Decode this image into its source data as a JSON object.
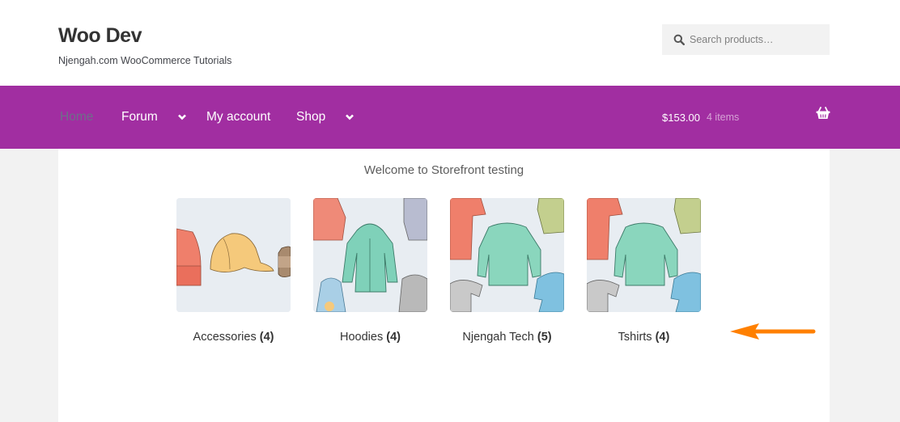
{
  "header": {
    "site_title": "Woo Dev",
    "tagline": "Njengah.com WooCommerce Tutorials",
    "search": {
      "placeholder": "Search products…",
      "value": "",
      "icon": "search-icon"
    }
  },
  "nav": {
    "items": [
      {
        "label": "Home",
        "active": true,
        "has_dropdown": false
      },
      {
        "label": "Forum",
        "active": false,
        "has_dropdown": true
      },
      {
        "label": "My account",
        "active": false,
        "has_dropdown": false
      },
      {
        "label": "Shop",
        "active": false,
        "has_dropdown": true
      }
    ],
    "cart": {
      "total": "$153.00",
      "count": "4 items",
      "icon": "basket-icon"
    }
  },
  "main": {
    "welcome": "Welcome to Storefront testing",
    "categories": [
      {
        "name": "Accessories",
        "count": "(4)",
        "image": "accessories-illustration"
      },
      {
        "name": "Hoodies",
        "count": "(4)",
        "image": "hoodies-illustration"
      },
      {
        "name": "Njengah Tech",
        "count": "(5)",
        "image": "tshirts-illustration"
      },
      {
        "name": "Tshirts",
        "count": "(4)",
        "image": "tshirts-illustration"
      }
    ]
  },
  "annotation": {
    "type": "arrow",
    "direction": "left",
    "color": "#ff8000"
  },
  "colors": {
    "brand_purple": "#a12ea1",
    "page_bg": "#f2f2f2",
    "text": "#333333"
  }
}
